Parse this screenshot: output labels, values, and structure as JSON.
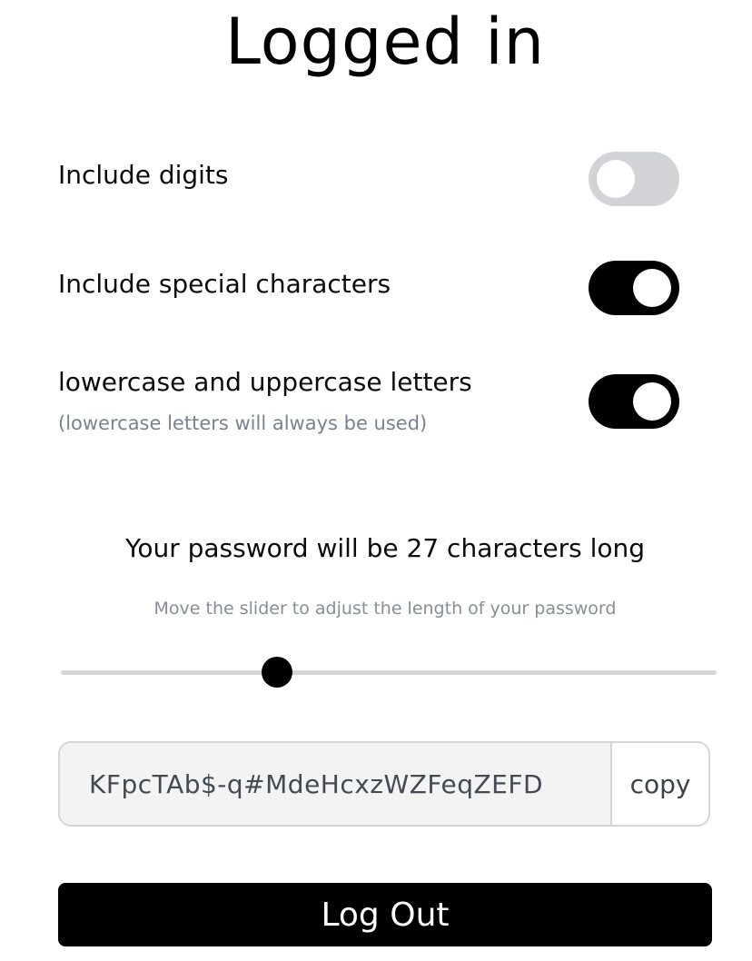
{
  "title": "Logged in",
  "options": [
    {
      "label": "Include digits",
      "enabled": false
    },
    {
      "label": "Include special characters",
      "enabled": true
    },
    {
      "label": "lowercase and uppercase letters",
      "sublabel": "(lowercase letters will always be used)",
      "enabled": true
    }
  ],
  "length": {
    "prefix": "Your password will be",
    "value": "27",
    "suffix": "characters long",
    "hint": "Move the slider to adjust the length of your password"
  },
  "slider": {
    "fraction": 0.33
  },
  "password": {
    "value": "KFpcTAb$-q#MdeHcxzWZFeqZEFD",
    "copy_label": "copy"
  },
  "logout_label": "Log Out",
  "colors": {
    "toggle_on": "#000000",
    "toggle_off": "#d2d3d7",
    "muted_text": "#7a8290",
    "button_bg": "#000000"
  }
}
